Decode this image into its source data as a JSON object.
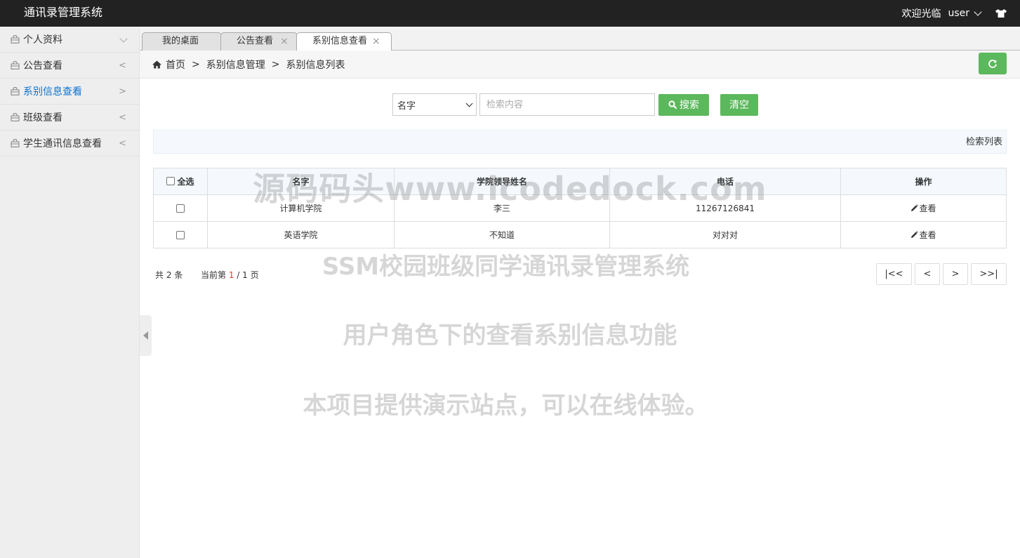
{
  "header": {
    "brand": "通讯录管理系统",
    "welcome": "欢迎光临",
    "user": "user"
  },
  "sidebar": {
    "items": [
      {
        "label": "个人资料",
        "arrow": "down"
      },
      {
        "label": "公告查看",
        "arrow": "<"
      },
      {
        "label": "系别信息查看",
        "arrow": ">",
        "active": true
      },
      {
        "label": "班级查看",
        "arrow": "<"
      },
      {
        "label": "学生通讯信息查看",
        "arrow": "<"
      }
    ]
  },
  "tabs": [
    {
      "label": "我的桌面"
    },
    {
      "label": "公告查看",
      "close": "×"
    },
    {
      "label": "系别信息查看",
      "close": "×",
      "active": true
    }
  ],
  "breadcrumb": {
    "home": "首页",
    "sep": ">",
    "level1": "系别信息管理",
    "level2": "系别信息列表"
  },
  "search": {
    "field_selected": "名字",
    "placeholder": "检索内容",
    "search_label": "搜索",
    "clear_label": "清空"
  },
  "result_label": "检索列表",
  "table": {
    "check_all": "全选",
    "headers": [
      "名字",
      "学院领导姓名",
      "电话",
      "操作"
    ],
    "rows": [
      {
        "name": "计算机学院",
        "leader": "李三",
        "phone": "11267126841",
        "action": "查看"
      },
      {
        "name": "英语学院",
        "leader": "不知道",
        "phone": "对对对",
        "action": "查看"
      }
    ]
  },
  "pager": {
    "total_prefix": "共",
    "total": "2",
    "total_suffix": "条",
    "current_prefix": "当前第",
    "current": "1",
    "slash": "/",
    "pages": "1",
    "pages_suffix": "页",
    "first": "|<<",
    "prev": "<",
    "next": ">",
    "last": ">>|"
  },
  "watermarks": {
    "line1": "源码码头www.icodedock.com",
    "line2": "SSM校园班级同学通讯录管理系统",
    "line3": "用户角色下的查看系别信息功能",
    "line4": "本项目提供演示站点，可以在线体验。"
  },
  "colors": {
    "header_bg": "#222222",
    "accent_green": "#5cb85c",
    "active_link": "#0d73d0"
  }
}
